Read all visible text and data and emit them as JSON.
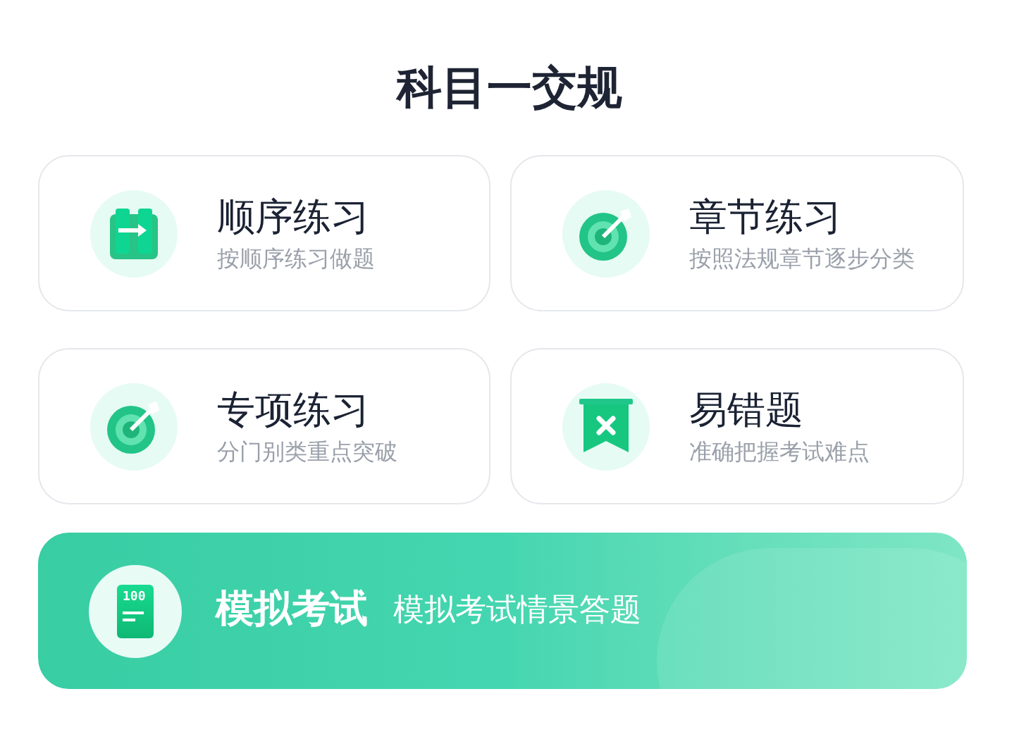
{
  "title": "科目一交规",
  "cards": [
    {
      "kind": "book",
      "title": "顺序练习",
      "subtitle": "按顺序练习做题"
    },
    {
      "kind": "target",
      "title": "章节练习",
      "subtitle": "按照法规章节逐步分类"
    },
    {
      "kind": "target",
      "title": "专项练习",
      "subtitle": "分门别类重点突破"
    },
    {
      "kind": "bookmark",
      "title": "易错题",
      "subtitle": "准确把握考试难点"
    }
  ],
  "banner": {
    "icon_text": "100",
    "title": "模拟考试",
    "subtitle": "模拟考试情景答题"
  }
}
